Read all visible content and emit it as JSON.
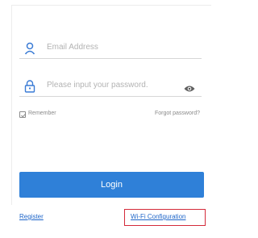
{
  "login_form": {
    "email_placeholder": "Email Address",
    "password_placeholder": "Please input your password.",
    "remember_label": "Remember",
    "forgot_password_label": "Forgot password?",
    "login_button_label": "Login",
    "register_label": "Register",
    "wifi_configuration_label": "Wi-Fi Configuration"
  },
  "colors": {
    "primary_button": "#2f80d8",
    "link": "#1f66c9",
    "highlight_box": "#d42a3a",
    "icon_blue": "#3a7bd5"
  },
  "icons": {
    "email": "user-icon",
    "password": "lock-icon",
    "show_password": "eye-icon"
  }
}
